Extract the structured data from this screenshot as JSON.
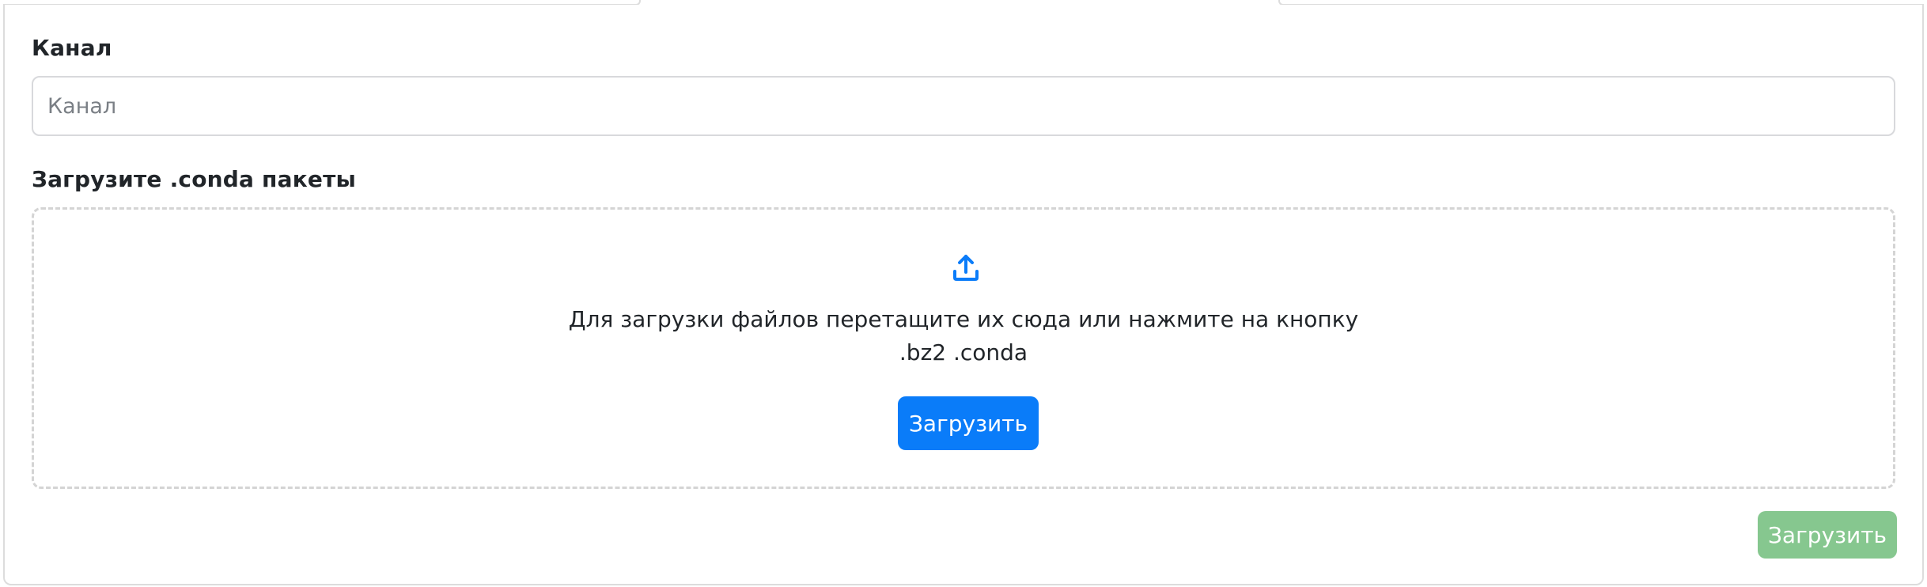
{
  "channel": {
    "label": "Канал",
    "value": "",
    "placeholder": "Канал"
  },
  "upload": {
    "label": "Загрузите .conda пакеты",
    "icon": "upload-icon",
    "hint": "Для загрузки файлов перетащите их сюда или нажмите на кнопку",
    "extensions": ".bz2 .conda",
    "button_label": "Загрузить"
  },
  "submit": {
    "label": "Загрузить"
  },
  "colors": {
    "primary": "#0a7cf9",
    "success_disabled": "#86c78f",
    "border": "#d8d9dc",
    "dashed_border": "#d4d4d4"
  }
}
